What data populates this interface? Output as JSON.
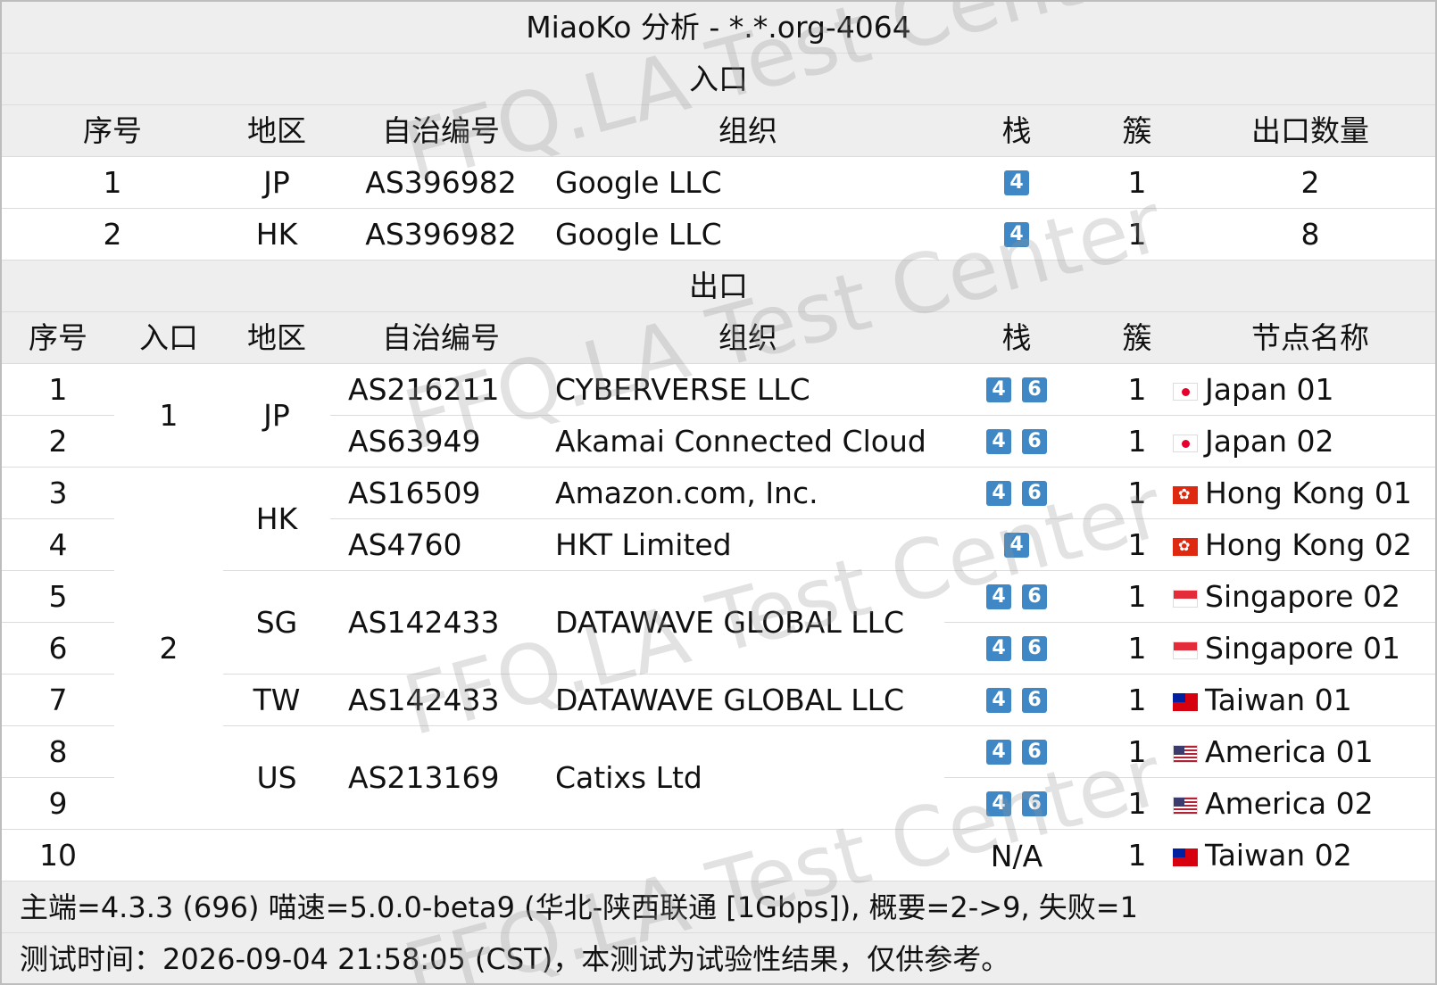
{
  "title": "MiaoKo 分析 - *.*.org-4064",
  "entry_section": "入口",
  "exit_section": "出口",
  "entry_headers": [
    "序号",
    "地区",
    "自治编号",
    "组织",
    "栈",
    "簇",
    "出口数量"
  ],
  "entry_rows": [
    {
      "idx": "1",
      "region": "JP",
      "asn": "AS396982",
      "org": "Google LLC",
      "stack": [
        "4"
      ],
      "cluster": "1",
      "count": "2"
    },
    {
      "idx": "2",
      "region": "HK",
      "asn": "AS396982",
      "org": "Google LLC",
      "stack": [
        "4"
      ],
      "cluster": "1",
      "count": "8"
    }
  ],
  "exit_headers": [
    "序号",
    "入口",
    "地区",
    "自治编号",
    "组织",
    "栈",
    "簇",
    "节点名称"
  ],
  "exit_rows": [
    {
      "idx": "1",
      "stack": [
        "4",
        "6"
      ],
      "cluster": "1",
      "flag": "jp",
      "node": "Japan 01"
    },
    {
      "idx": "2",
      "stack": [
        "4",
        "6"
      ],
      "cluster": "1",
      "flag": "jp",
      "node": "Japan 02"
    },
    {
      "idx": "3",
      "stack": [
        "4",
        "6"
      ],
      "cluster": "1",
      "flag": "hk",
      "node": "Hong Kong 01"
    },
    {
      "idx": "4",
      "stack": [
        "4"
      ],
      "cluster": "1",
      "flag": "hk",
      "node": "Hong Kong 02"
    },
    {
      "idx": "5",
      "stack": [
        "4",
        "6"
      ],
      "cluster": "1",
      "flag": "sg",
      "node": "Singapore 02"
    },
    {
      "idx": "6",
      "stack": [
        "4",
        "6"
      ],
      "cluster": "1",
      "flag": "sg",
      "node": "Singapore 01"
    },
    {
      "idx": "7",
      "stack": [
        "4",
        "6"
      ],
      "cluster": "1",
      "flag": "tw",
      "node": "Taiwan 01"
    },
    {
      "idx": "8",
      "stack": [
        "4",
        "6"
      ],
      "cluster": "1",
      "flag": "us",
      "node": "America 01"
    },
    {
      "idx": "9",
      "stack": [
        "4",
        "6"
      ],
      "cluster": "1",
      "flag": "us",
      "node": "America 02"
    },
    {
      "idx": "10",
      "stack_text": "N/A",
      "cluster": "1",
      "flag": "tw",
      "node": "Taiwan 02"
    }
  ],
  "exit_entry_groups": [
    {
      "value": "1",
      "rows": [
        1,
        2
      ]
    },
    {
      "value": "2",
      "rows": [
        3,
        9
      ]
    }
  ],
  "exit_region_groups": [
    {
      "value": "JP",
      "rows": [
        1,
        2
      ]
    },
    {
      "value": "HK",
      "rows": [
        3,
        4
      ]
    },
    {
      "value": "SG",
      "rows": [
        5,
        6
      ]
    },
    {
      "value": "TW",
      "rows": [
        7,
        7
      ]
    },
    {
      "value": "US",
      "rows": [
        8,
        9
      ]
    }
  ],
  "exit_asn_org_groups": [
    {
      "asn": "AS216211",
      "org": "CYBERVERSE LLC",
      "rows": [
        1,
        1
      ]
    },
    {
      "asn": "AS63949",
      "org": "Akamai Connected Cloud",
      "rows": [
        2,
        2
      ]
    },
    {
      "asn": "AS16509",
      "org": "Amazon.com, Inc.",
      "rows": [
        3,
        3
      ]
    },
    {
      "asn": "AS4760",
      "org": "HKT Limited",
      "rows": [
        4,
        4
      ]
    },
    {
      "asn": "AS142433",
      "org": "DATAWAVE GLOBAL LLC",
      "rows": [
        5,
        6
      ]
    },
    {
      "asn": "AS142433",
      "org": "DATAWAVE GLOBAL LLC",
      "rows": [
        7,
        7
      ]
    },
    {
      "asn": "AS213169",
      "org": "Catixs Ltd",
      "rows": [
        8,
        9
      ]
    }
  ],
  "footer_line1": "主端=4.3.3 (696) 喵速=5.0.0-beta9 (华北-陕西联通 [1Gbps]), 概要=2->9, 失败=1",
  "footer_line2": "测试时间：2026-09-04 21:58:05 (CST)，本测试为试验性结果，仅供参考。",
  "watermark": "FFQ.LA Test Center",
  "colors": {
    "header_bg": "#eeeeee",
    "badge": "#3f88c5",
    "grid": "#dcdcdc"
  }
}
